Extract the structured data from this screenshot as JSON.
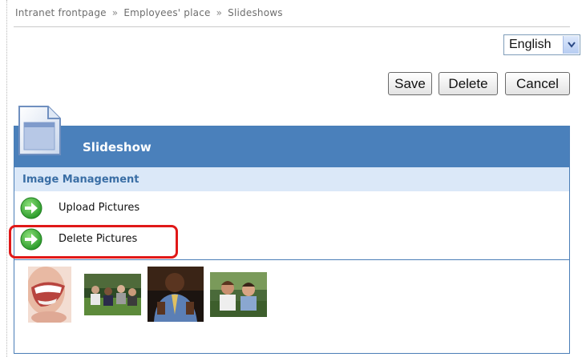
{
  "breadcrumb": {
    "items": [
      "Intranet frontpage",
      "Employees' place",
      "Slideshows"
    ],
    "separator": "»"
  },
  "language_select": {
    "value": "English",
    "icon": "chevron-down-icon"
  },
  "toolbar": {
    "save_label": "Save",
    "delete_label": "Delete",
    "cancel_label": "Cancel"
  },
  "panel": {
    "title": "Slideshow",
    "icon": "document-icon",
    "section_title": "Image Management",
    "menu": [
      {
        "label": "Upload Pictures",
        "icon": "green-arrow-icon"
      },
      {
        "label": "Delete Pictures",
        "icon": "green-arrow-icon",
        "highlighted": true
      }
    ],
    "thumbnails": [
      {
        "name": "smiling-mouth-photo"
      },
      {
        "name": "group-outdoors-photo"
      },
      {
        "name": "man-in-suit-photo"
      },
      {
        "name": "women-outdoors-photo"
      }
    ]
  },
  "colors": {
    "header": "#4a80bb",
    "subheader": "#dbe8f8",
    "highlight": "#e01818",
    "arrow": "#3fb43f"
  }
}
